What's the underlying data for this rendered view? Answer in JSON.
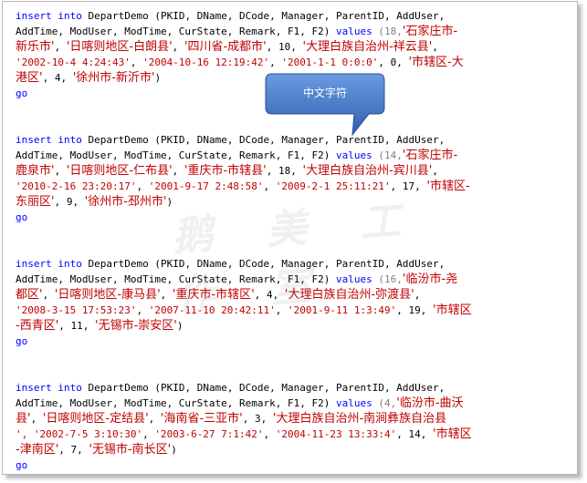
{
  "watermark": "鹅 美 工 作 室",
  "callout": {
    "text": "中文字符"
  },
  "statements": [
    {
      "l1": {
        "kw": "insert into",
        "table": "DepartDemo",
        "cols": "(PKID, DName, DCode, Manager, ParentID, AddUser,",
        "pre": "",
        "s1": ""
      },
      "l2": {
        "cols": "AddTime, ModUser, ModTime, CurState, Remark, F1, F2)",
        "values_kw": "values",
        "open": "(18,",
        "s1": "'石家庄市-"
      },
      "l3": {
        "s1": "新乐市'",
        "c1": ",",
        "s2": "'日喀则地区-白朗县'",
        "c2": ",",
        "s3": "'四川省-成都市'",
        "c3": ",",
        "n1": "10,",
        "s4": "'大理白族自治州-祥云县'",
        "c4": ","
      },
      "l4": {
        "s1": "'2002-10-4 4:24:43'",
        "s2": "'2004-10-16 12:19:42'",
        "s3": "'2001-1-1 0:0:0'",
        "n1": "0,",
        "s4": "'市辖区-大"
      },
      "l5": {
        "s1": "港区'",
        "n1": "4,",
        "s2": "'徐州市-新沂市'",
        "close": ")"
      },
      "go": "go"
    },
    {
      "l1": {
        "kw": "insert into",
        "table": "DepartDemo",
        "cols": "(PKID, DName, DCode, Manager, ParentID, AddUser,"
      },
      "l2": {
        "cols": "AddTime, ModUser, ModTime, CurState, Remark, F1, F2)",
        "values_kw": "values",
        "open": "(14,",
        "s1": "'石家庄市-"
      },
      "l3": {
        "s1": "鹿泉市'",
        "c1": ",",
        "s2": "'日喀则地区-仁布县'",
        "c2": ",",
        "s3": "'重庆市-市辖县'",
        "c3": ",",
        "n1": "18,",
        "s4": "'大理白族自治州-宾川县'",
        "c4": ","
      },
      "l4": {
        "s1": "'2010-2-16 23:20:17'",
        "s2": "'2001-9-17 2:48:58'",
        "s3": "'2009-2-1 25:11:21'",
        "n1": "17,",
        "s4": "'市辖区-"
      },
      "l5": {
        "s1": "东丽区'",
        "n1": "9,",
        "s2": "'徐州市-邳州市'",
        "close": ")"
      },
      "go": "go"
    },
    {
      "l1": {
        "kw": "insert into",
        "table": "DepartDemo",
        "cols": "(PKID, DName, DCode, Manager, ParentID, AddUser,"
      },
      "l2": {
        "cols": "AddTime, ModUser, ModTime, CurState, Remark, F1, F2)",
        "values_kw": "values",
        "open": "(16,",
        "s1": "'临汾市-尧"
      },
      "l3": {
        "s1": "都区'",
        "c1": ",",
        "s2": "'日喀则地区-康马县'",
        "c2": ",",
        "s3": "'重庆市-市辖区'",
        "c3": ",",
        "n1": "4,",
        "s4": "'大理白族自治州-弥渡县'",
        "c4": ","
      },
      "l4": {
        "s1": "'2008-3-15 17:53:23'",
        "s2": "'2007-11-10 20:42:11'",
        "s3": "'2001-9-11 1:3:49'",
        "n1": "19,",
        "s4": "'市辖区"
      },
      "l5": {
        "s1": "-西青区'",
        "n1": "11,",
        "s2": "'无锡市-崇安区'",
        "close": ")"
      },
      "go": "go"
    },
    {
      "l1": {
        "kw": "insert into",
        "table": "DepartDemo",
        "cols": "(PKID, DName, DCode, Manager, ParentID, AddUser,"
      },
      "l2": {
        "cols": "AddTime, ModUser, ModTime, CurState, Remark, F1, F2)",
        "values_kw": "values",
        "open": "(4,",
        "s1": "'临汾市-曲沃"
      },
      "l3": {
        "s1": "县'",
        "c1": ",",
        "s2": "'日喀则地区-定结县'",
        "c2": ",",
        "s3": "'海南省-三亚市'",
        "c3": ",",
        "n1": "3,",
        "s4": "'大理白族自治州-南涧彝族自治县"
      },
      "l4": {
        "s1": "', '2002-7-5 3:10:30'",
        "s2": "'2003-6-27 7:1:42'",
        "s3": "'2004-11-23 13:33:4'",
        "n1": "14,",
        "s4": "'市辖区"
      },
      "l5": {
        "s1": "-津南区'",
        "n1": "7,",
        "s2": "'无锡市-南长区'",
        "close": ")"
      },
      "go": "go"
    }
  ]
}
